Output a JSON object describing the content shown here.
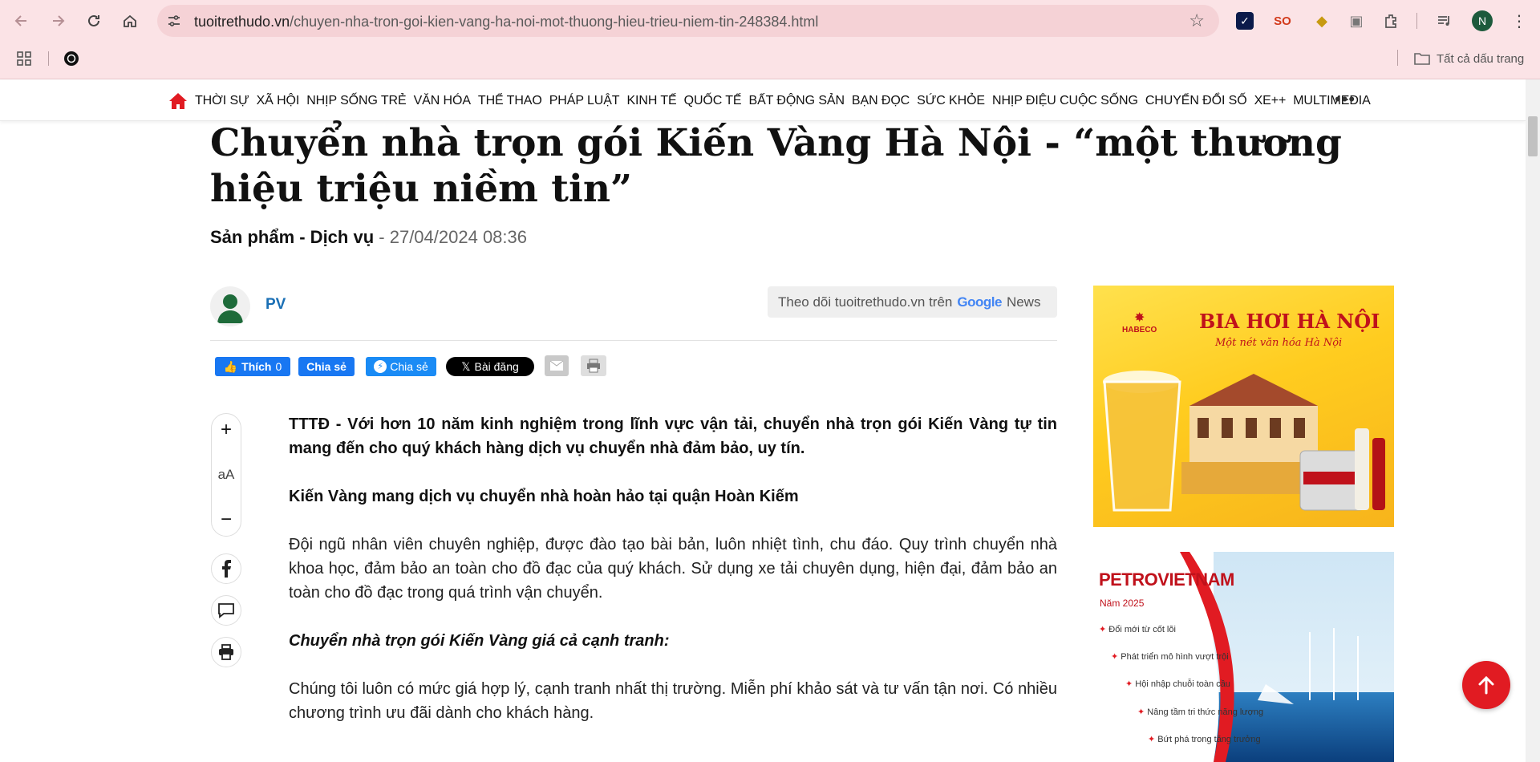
{
  "browser": {
    "url_host": "tuoitrethudo.vn",
    "url_path": "/chuyen-nha-tron-goi-kien-vang-ha-noi-mot-thuong-hieu-trieu-niem-tin-248384.html",
    "profile_initial": "N",
    "bookmarks_all_label": "Tất cả dấu trang",
    "icons": [
      "back-icon",
      "forward-icon",
      "reload-icon",
      "home-icon",
      "star-icon",
      "extensions-icon",
      "menu-icon"
    ]
  },
  "nav": {
    "items": [
      "THỜI SỰ",
      "XÃ HỘI",
      "NHỊP SỐNG TRẺ",
      "VĂN HÓA",
      "THỂ THAO",
      "PHÁP LUẬT",
      "KINH TẾ",
      "QUỐC TẾ",
      "BẤT ĐỘNG SẢN",
      "BẠN ĐỌC",
      "SỨC KHỎE",
      "NHỊP ĐIỆU CUỘC SỐNG",
      "CHUYỂN ĐỔI SỐ",
      "XE++",
      "MULTIMEDIA"
    ],
    "more": "•••",
    "brand_color": "#e11b22"
  },
  "article": {
    "title": "Chuyển nhà trọn gói Kiến Vàng Hà Nội - “một thương hiệu triệu niềm tin”",
    "category": "Sản phẩm - Dịch vụ",
    "date": "- 27/04/2024 08:36",
    "author": "PV",
    "follow_text": "Theo dõi tuoitrethudo.vn trên",
    "google": "Google",
    "news": "News",
    "paragraphs": {
      "lead": "TTTĐ - Với hơn 10 năm kinh nghiệm trong lĩnh vực vận tải, chuyển nhà trọn gói Kiến Vàng tự tin mang đến cho quý khách hàng dịch vụ chuyển nhà đảm bảo, uy tín.",
      "sub1": "Kiến Vàng mang dịch vụ chuyển nhà hoàn hảo tại quận Hoàn Kiếm",
      "p1": "Đội ngũ nhân viên chuyên nghiệp, được đào tạo bài bản, luôn nhiệt tình, chu đáo. Quy trình chuyển nhà khoa học, đảm bảo an toàn cho đồ đạc của quý khách. Sử dụng xe tải chuyên dụng, hiện đại, đảm bảo an toàn cho đồ đạc trong quá trình vận chuyển.",
      "sub2": "Chuyển nhà trọn gói Kiến Vàng giá cả cạnh tranh:",
      "p2": "Chúng tôi luôn có mức giá hợp lý, cạnh tranh nhất thị trường. Miễn phí khảo sát và tư vấn tận nơi. Có nhiều chương trình ưu đãi dành cho khách hàng."
    }
  },
  "share": {
    "like": "Thích",
    "like_count": "0",
    "fb_share": "Chia sẻ",
    "messenger_share": "Chia sẻ",
    "x_post": "Bài đăng"
  },
  "tools": {
    "font_label": "aA",
    "plus": "+",
    "minus": "−"
  },
  "ads": {
    "ad1_title": "BIA HƠI HÀ NỘI",
    "ad1_slogan": "Một nét văn hóa Hà Nội",
    "ad1_brand": "HABECO",
    "ad2_brand": "PETROVIETNAM",
    "ad2_year": "Năm 2025",
    "ad2_lines": [
      "Đổi mới từ cốt lõi",
      "Phát triển mô hình vượt trội",
      "Hội nhập chuỗi toàn cầu",
      "Nâng tầm tri thức năng lượng",
      "Bứt phá trong tăng trưởng"
    ]
  }
}
